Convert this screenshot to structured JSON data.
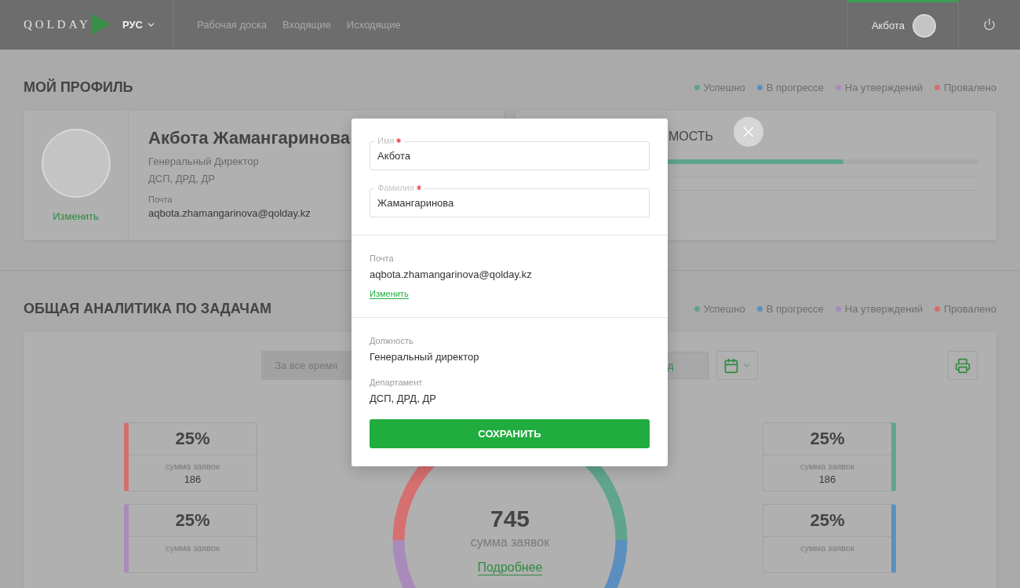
{
  "header": {
    "logo": "QOLDAY",
    "language": "РУС",
    "nav": [
      {
        "label": "Рабочая доска"
      },
      {
        "label": "Входящие"
      },
      {
        "label": "Исходящие"
      }
    ],
    "user": {
      "name": "Акбота"
    }
  },
  "profile_section": {
    "title": "МОЙ ПРОФИЛЬ",
    "legend": [
      {
        "label": "Успешно",
        "color": "#5fa58c"
      },
      {
        "label": "В прогрессе",
        "color": "#5a8fbf"
      },
      {
        "label": "На утверждений",
        "color": "#a98bba"
      },
      {
        "label": "Провалено",
        "color": "#d66f6f"
      }
    ],
    "profile_card": {
      "change_link": "Изменить",
      "full_name": "Акбота Жамангаринова",
      "position": "Генеральный Директор",
      "department": "ДСП, ДРД, ДР",
      "email_label": "Почта",
      "email": "aqbota.zhamangarinova@qolday.kz"
    },
    "second_card": {
      "title": "МОСТЬ",
      "level": 0.69
    }
  },
  "analytics_section": {
    "title": "ОБЩАЯ АНАЛИТИКА ПО ЗАДАЧАМ",
    "legend": [
      {
        "label": "Успешно",
        "color": "#5fa58c"
      },
      {
        "label": "В прогрессе",
        "color": "#5a8fbf"
      },
      {
        "label": "На утверждений",
        "color": "#a98bba"
      },
      {
        "label": "Провалено",
        "color": "#d66f6f"
      }
    ],
    "filters": {
      "period": "За все время",
      "date_field": "д"
    },
    "stat_cards": [
      {
        "kind": "left",
        "color": "#d66f6f",
        "percent": "25%",
        "label": "сумма заявок",
        "value": "186"
      },
      {
        "kind": "left",
        "color": "#a98bba",
        "percent": "25%",
        "label": "сумма заявок"
      },
      {
        "kind": "right",
        "color": "#5fa58c",
        "percent": "25%",
        "label": "сумма заявок",
        "value": "186"
      },
      {
        "kind": "right",
        "color": "#5a8fbf",
        "percent": "25%",
        "label": "сумма заявок"
      }
    ],
    "donut": {
      "total": "745",
      "label": "сумма заявок",
      "link": "Подробнее"
    }
  },
  "modal": {
    "fields": [
      {
        "label": "Имя",
        "required": true,
        "value": "Акбота"
      },
      {
        "label": "Фамилия",
        "required": true,
        "value": "Жамангаринова"
      }
    ],
    "email_label": "Почта",
    "email": "aqbota.zhamangarinova@qolday.kz",
    "change_link": "Изменить",
    "info": [
      {
        "label": "Должность",
        "value": "Генеральный директор"
      },
      {
        "label": "Департамент",
        "value": "ДСП, ДРД, ДР"
      }
    ],
    "save_button": "СОХРАНИТЬ"
  }
}
